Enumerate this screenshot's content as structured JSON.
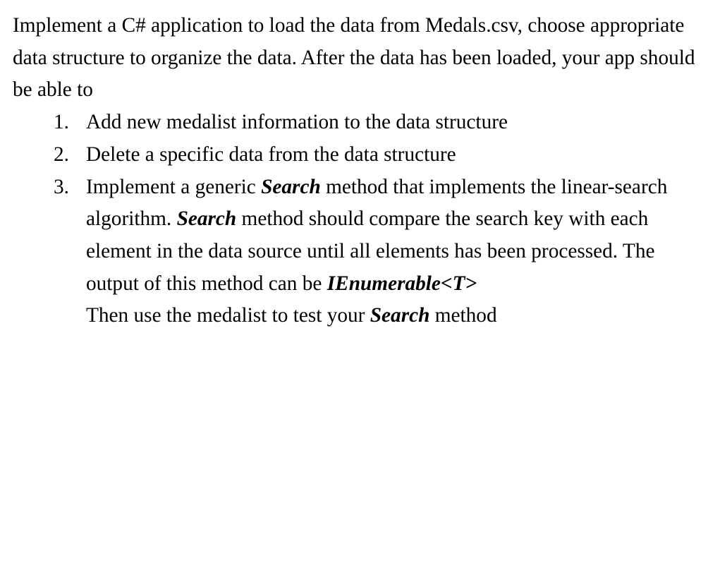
{
  "intro": "Implement a C# application to load the data from Medals.csv, choose appropriate data structure to organize the data. After the data has been loaded, your app should be able to",
  "items": [
    {
      "text": "Add new medalist information to the data structure"
    },
    {
      "text": "Delete a specific data from the data structure"
    },
    {
      "part1": "Implement a generic ",
      "search1": "Search",
      "part2": " method that implements the linear-search algorithm. ",
      "search2": "Search",
      "part3": " method should compare the search key with each element in the data source until all elements has been processed. The output of this method can be ",
      "ienum": "IEnumerable<T>",
      "followPart1": "Then use the medalist to test your ",
      "search3": "Search",
      "followPart2": " method"
    }
  ]
}
